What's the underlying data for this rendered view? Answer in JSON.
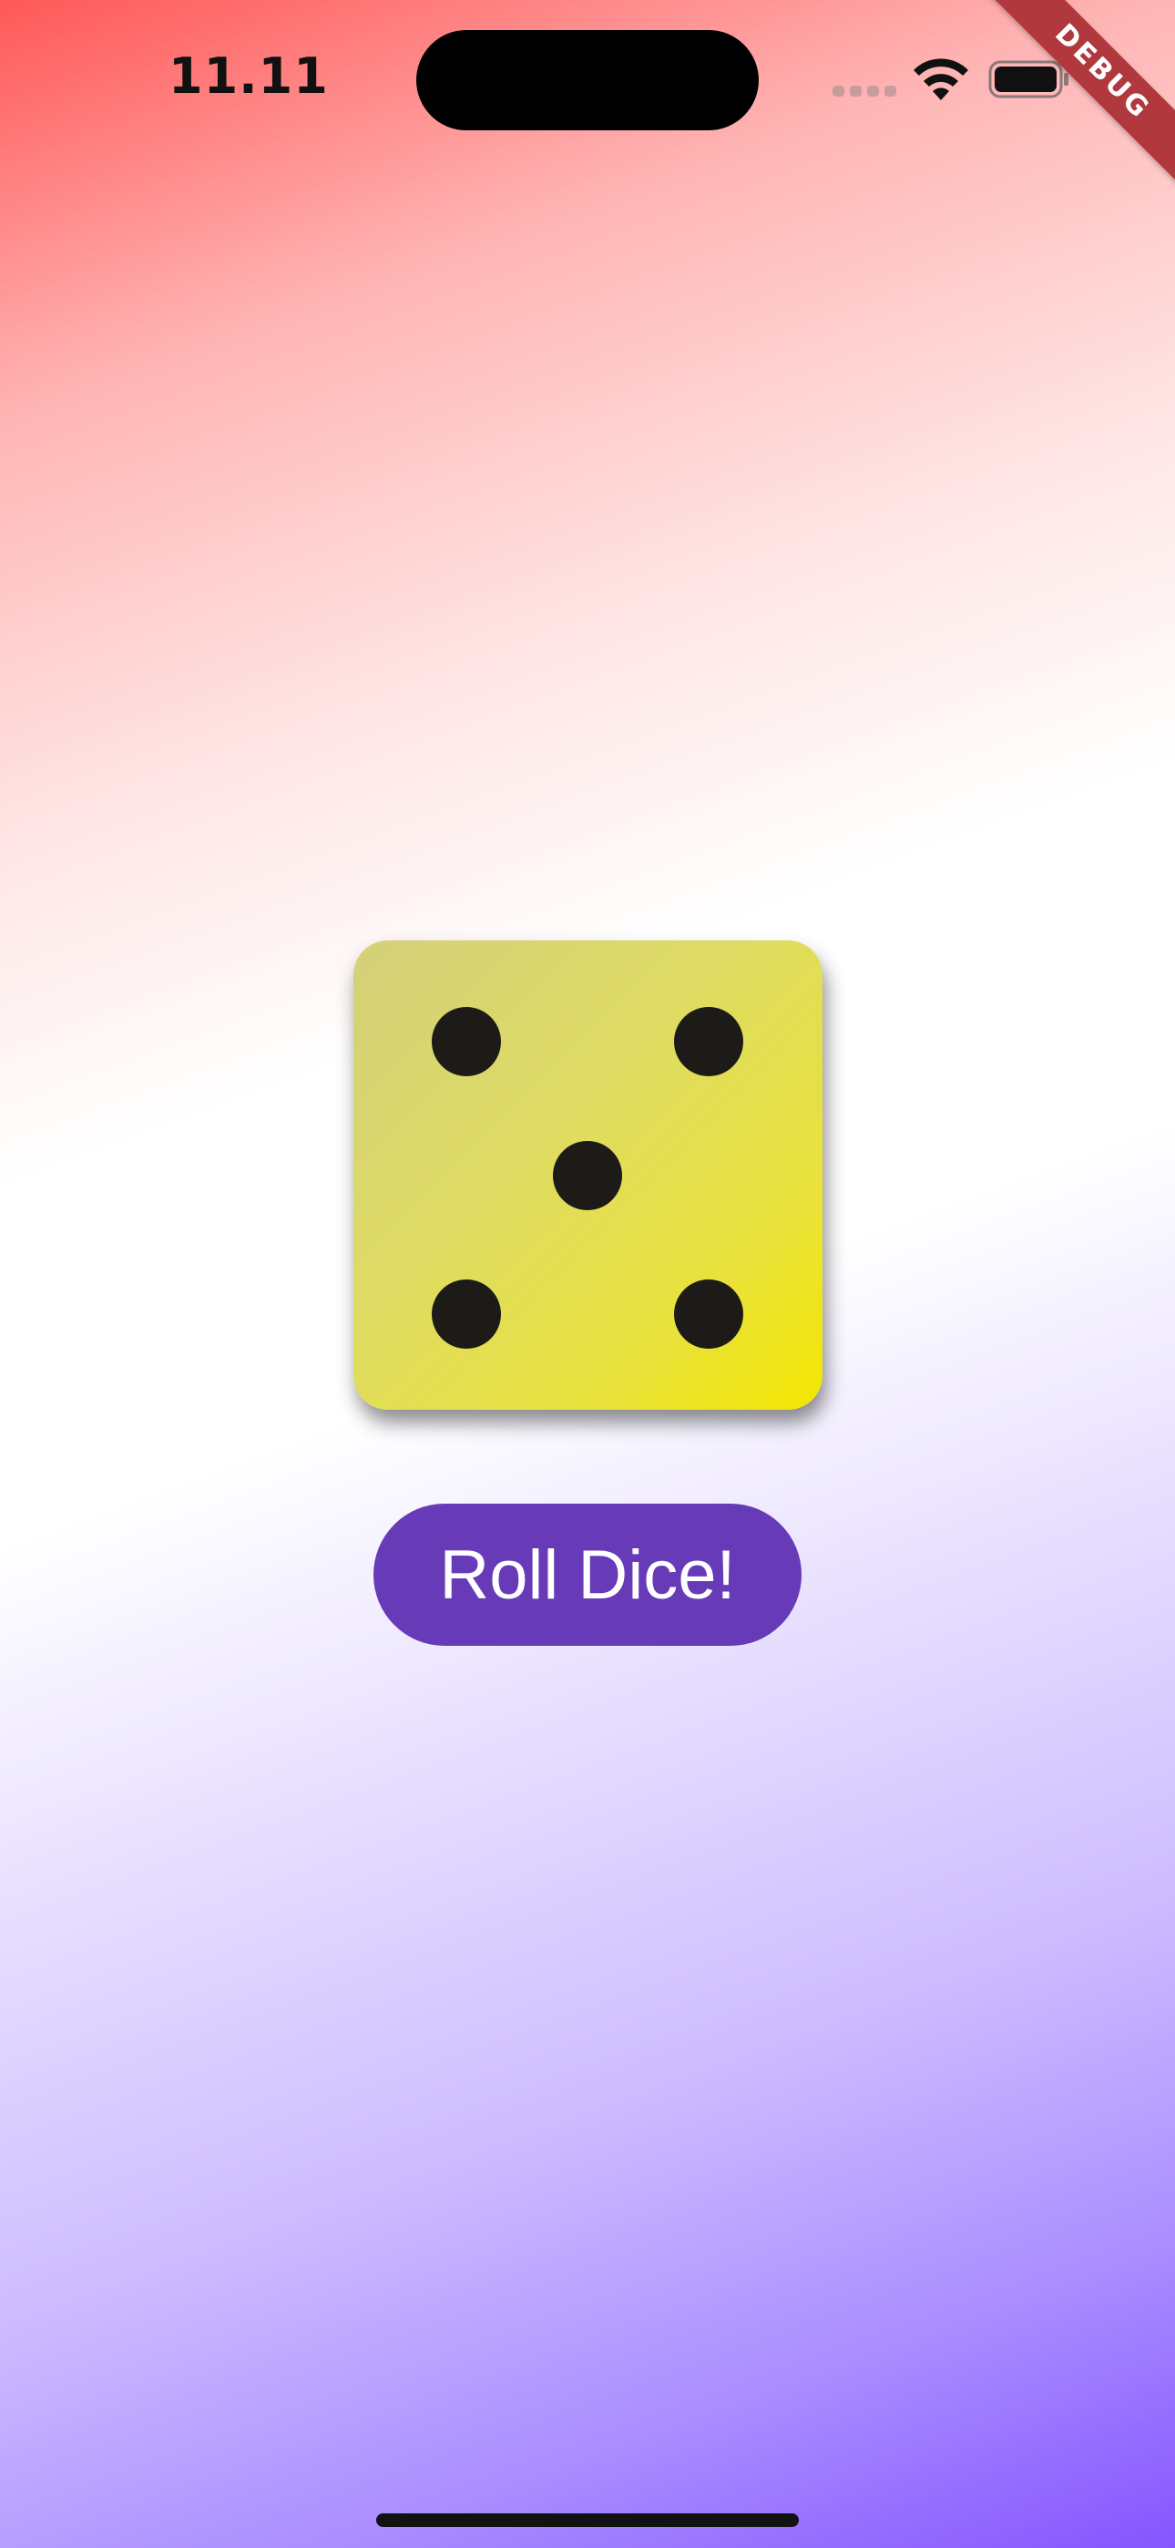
{
  "status_bar": {
    "time": "11.11",
    "icons": [
      "cellular-signal-icon",
      "wifi-icon",
      "battery-icon"
    ]
  },
  "debug_banner": {
    "label": "DEBUG",
    "color": "#b1383c"
  },
  "dice": {
    "face_value": 5,
    "pip_color": "#1c1b18",
    "face_colors": [
      "#d4d07a",
      "#f3e600"
    ]
  },
  "roll_button": {
    "label": "Roll Dice!",
    "color": "#673ab7",
    "text_color": "#ffffff"
  },
  "background": {
    "gradient_colors": [
      "#ff5858",
      "#ffffff",
      "#8655ff"
    ]
  }
}
